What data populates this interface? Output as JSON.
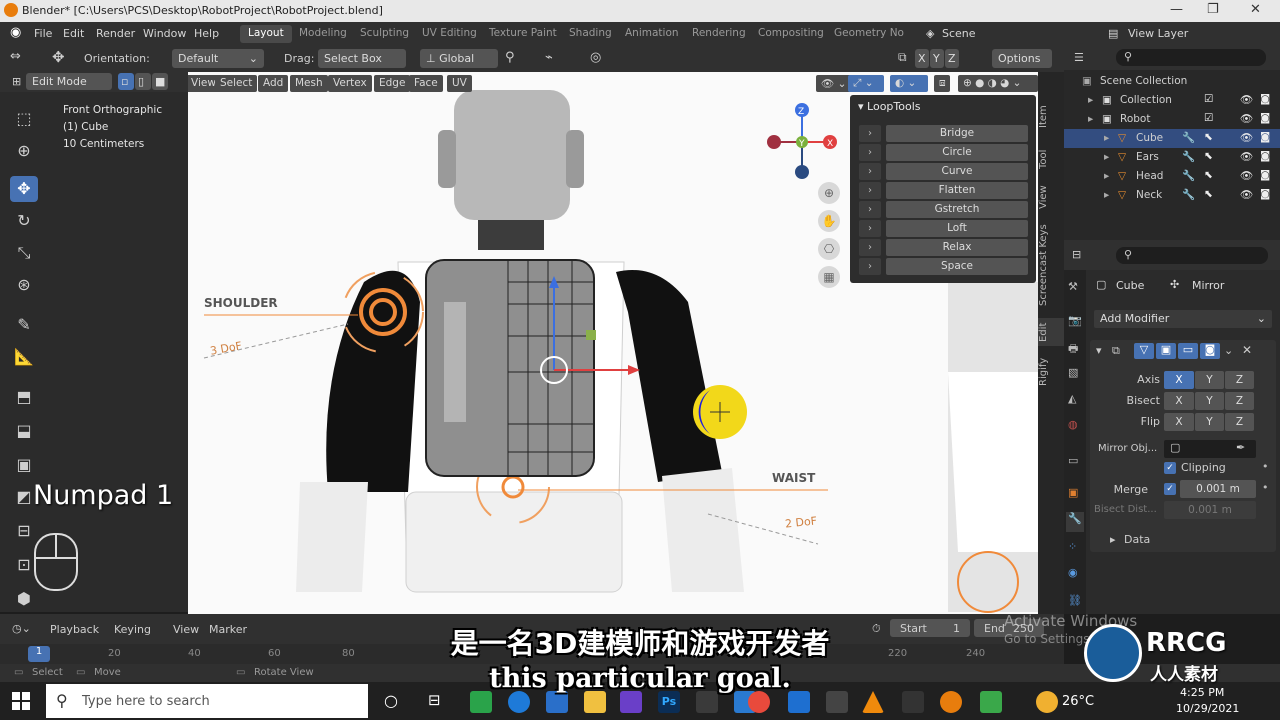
{
  "window": {
    "title": "Blender* [C:\\Users\\PCS\\Desktop\\RobotProject\\RobotProject.blend]"
  },
  "menu": [
    "File",
    "Edit",
    "Render",
    "Window",
    "Help"
  ],
  "workspaces": [
    "Layout",
    "Modeling",
    "Sculpting",
    "UV Editing",
    "Texture Paint",
    "Shading",
    "Animation",
    "Rendering",
    "Compositing",
    "Geometry No"
  ],
  "active_workspace": "Layout",
  "scene": "Scene",
  "view_layer": "View Layer",
  "header": {
    "orientation_label": "Orientation:",
    "orientation_value": "Default",
    "drag_label": "Drag:",
    "drag_value": "Select Box",
    "transform_orientation": "Global",
    "axes": [
      "X",
      "Y",
      "Z"
    ],
    "options": "Options"
  },
  "mode": "Edit Mode",
  "viewport_menu": [
    "View",
    "Select",
    "Add",
    "Mesh",
    "Vertex",
    "Edge",
    "Face",
    "UV"
  ],
  "viewport_info": [
    "Front Orthographic",
    "(1) Cube",
    "10 Centimeters"
  ],
  "overlay_labels": {
    "shoulder": "SHOULDER",
    "shoulder_dof": "3 DoF",
    "waist": "WAIST",
    "waist_dof": "2 DoF",
    "numpad": "Numpad 1"
  },
  "looptools": {
    "title": "LoopTools",
    "items": [
      "Bridge",
      "Circle",
      "Curve",
      "Flatten",
      "Gstretch",
      "Loft",
      "Relax",
      "Space"
    ]
  },
  "sidebar_tabs": [
    "Item",
    "Tool",
    "View",
    "Screencast Keys",
    "Edit",
    "Rigify"
  ],
  "outliner": {
    "root": "Scene Collection",
    "rows": [
      {
        "name": "Collection",
        "indent": 1,
        "selected": false
      },
      {
        "name": "Robot",
        "indent": 1,
        "selected": false
      },
      {
        "name": "Cube",
        "indent": 2,
        "selected": true
      },
      {
        "name": "Ears",
        "indent": 2,
        "selected": false
      },
      {
        "name": "Head",
        "indent": 2,
        "selected": false
      },
      {
        "name": "Neck",
        "indent": 2,
        "selected": false
      }
    ]
  },
  "properties": {
    "object": "Cube",
    "modifier": "Mirror",
    "add_modifier": "Add Modifier",
    "axis_label": "Axis",
    "bisect_label": "Bisect",
    "flip_label": "Flip",
    "axes": [
      "X",
      "Y",
      "Z"
    ],
    "mirror_object_label": "Mirror Obj...",
    "clipping_label": "Clipping",
    "merge_label": "Merge",
    "merge_value": "0.001 m",
    "bisect_distance_label": "Bisect Dist...",
    "bisect_distance_value": "0.001 m",
    "data_label": "Data"
  },
  "timeline": {
    "menus": [
      "Playback",
      "Keying",
      "View",
      "Marker"
    ],
    "start_label": "Start",
    "start_value": "1",
    "end_label": "End",
    "end_value": "250",
    "frame_current": "1",
    "ticks": [
      "20",
      "40",
      "60",
      "80",
      "220",
      "240"
    ]
  },
  "status": [
    "Select",
    "Move",
    "Rotate View"
  ],
  "activation": {
    "line1": "Activate Windows",
    "line2": "Go to Settings"
  },
  "taskbar": {
    "search_placeholder": "Type here to search",
    "temperature": "26°C",
    "time": "4:25 PM",
    "date": "10/29/2021"
  },
  "subtitles": {
    "cn": "是一名3D建模师和游戏开发者",
    "en": "this particular goal."
  },
  "watermark": {
    "logo": "RRCG",
    "cn": "人人素材"
  }
}
